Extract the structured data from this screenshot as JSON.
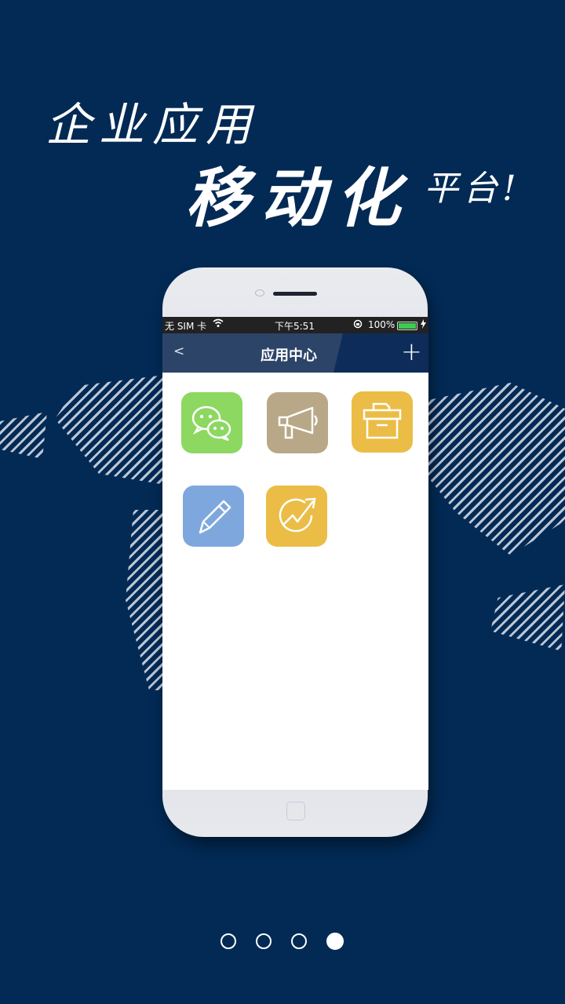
{
  "headline": {
    "line1": "企业应用",
    "line2": "移动化",
    "line3": "平台!"
  },
  "status_bar": {
    "carrier": "无 SIM 卡",
    "time": "下午5:51",
    "battery": "100%"
  },
  "nav": {
    "back": "<",
    "title": "应用中心",
    "add": "+"
  },
  "apps": [
    {
      "icon": "wechat-icon",
      "color": "#8cd861"
    },
    {
      "icon": "megaphone-icon",
      "color": "#b8a888"
    },
    {
      "icon": "archive-box-icon",
      "color": "#ebbd46"
    },
    {
      "icon": "pencil-icon",
      "color": "#7ea8dd"
    },
    {
      "icon": "growth-chart-icon",
      "color": "#ebbd46"
    }
  ],
  "pager": {
    "pages": 4,
    "current": 4
  },
  "colors": {
    "background": "#022a55",
    "navbar": "#0d2c59",
    "active_dot": "#ffffff"
  }
}
